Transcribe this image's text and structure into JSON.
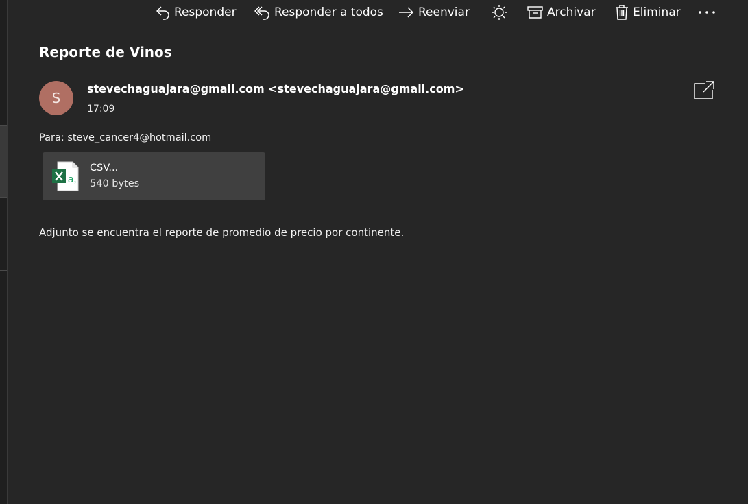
{
  "toolbar": {
    "reply_label": "Responder",
    "reply_all_label": "Responder a todos",
    "forward_label": "Reenviar",
    "archive_label": "Archivar",
    "delete_label": "Eliminar",
    "icons": {
      "reply": "reply-icon",
      "reply_all": "reply-all-icon",
      "forward": "forward-icon",
      "sweep": "sun-icon",
      "archive": "archive-icon",
      "delete": "trash-icon",
      "more": "more-icon"
    }
  },
  "message": {
    "subject": "Reporte de Vinos",
    "avatar_initial": "S",
    "avatar_color": "#b06f63",
    "sender": "stevechaguajara@gmail.com <stevechaguajara@gmail.com>",
    "time": "17:09",
    "to_line": "Para: steve_cancer4@hotmail.com",
    "attachment": {
      "name": "CSV...",
      "size": "540 bytes",
      "icon": "excel-file-icon"
    },
    "body": "Adjunto se encuentra el reporte de promedio de precio por continente."
  },
  "colors": {
    "background": "#262626",
    "attachment_background": "#404040",
    "excel_green": "#1e7145"
  }
}
